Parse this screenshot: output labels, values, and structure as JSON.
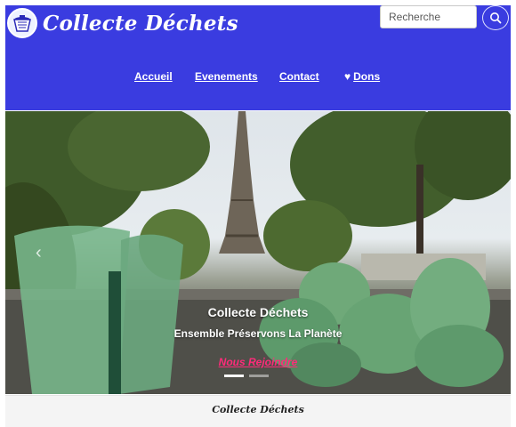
{
  "site": {
    "name": "Collecte Déchets"
  },
  "search": {
    "placeholder": "Recherche"
  },
  "nav": {
    "items": [
      {
        "label": "Accueil"
      },
      {
        "label": "Evenements"
      },
      {
        "label": "Contact"
      },
      {
        "label": "Dons",
        "icon": "heart-icon"
      }
    ]
  },
  "hero": {
    "title": "Collecte Déchets",
    "subtitle": "Ensemble Préservons La Planète",
    "cta": "Nous Rejoindre",
    "slides": 2,
    "active_slide": 1
  },
  "footer_strip": {
    "title": "Collecte Déchets"
  },
  "colors": {
    "header_bg": "#3a3ce0",
    "cta": "#ff2b7a",
    "white": "#ffffff"
  }
}
